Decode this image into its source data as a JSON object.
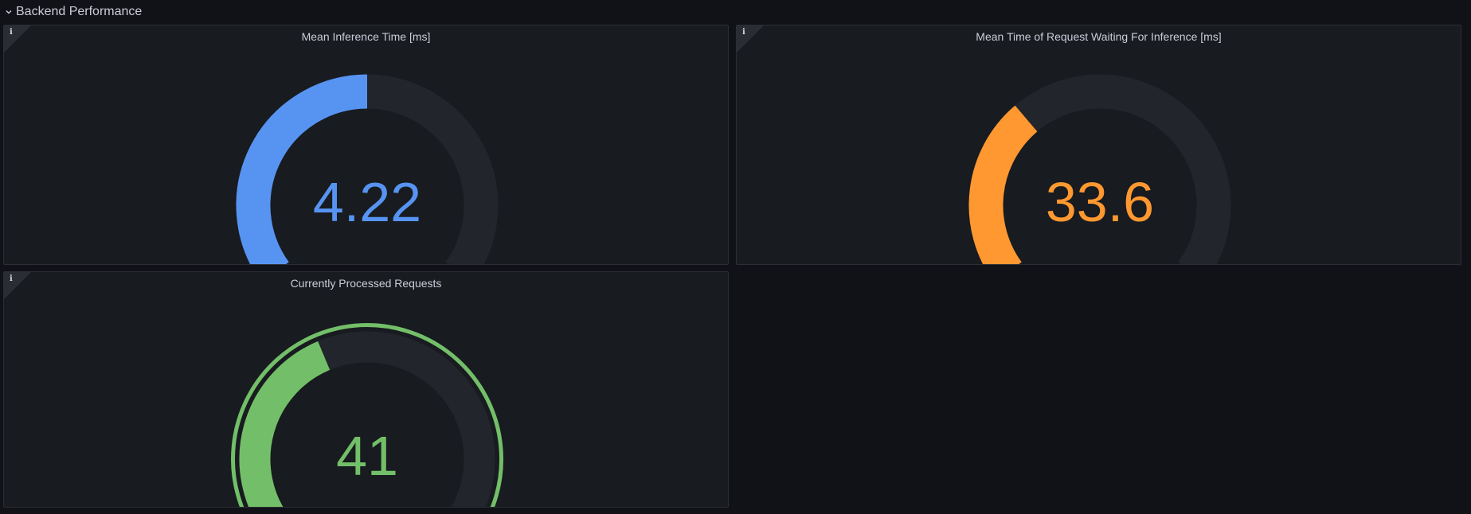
{
  "section": {
    "title": "Backend Performance"
  },
  "colors": {
    "background": "#111217",
    "panel": "#181b1f",
    "track": "#22252b",
    "blue": "#5794f2",
    "orange": "#ff9830",
    "green": "#73bf69"
  },
  "panels": [
    {
      "title": "Mean Inference Time [ms]",
      "value_text": "4.22",
      "fill_fraction": 0.5,
      "color": "#5794f2",
      "threshold_outline": false
    },
    {
      "title": "Mean Time of Request Waiting For Inference [ms]",
      "value_text": "33.6",
      "fill_fraction": 0.34,
      "color": "#ff9830",
      "threshold_outline": false
    },
    {
      "title": "Currently Processed Requests",
      "value_text": "41",
      "fill_fraction": 0.41,
      "color": "#73bf69",
      "threshold_outline": true
    }
  ]
}
